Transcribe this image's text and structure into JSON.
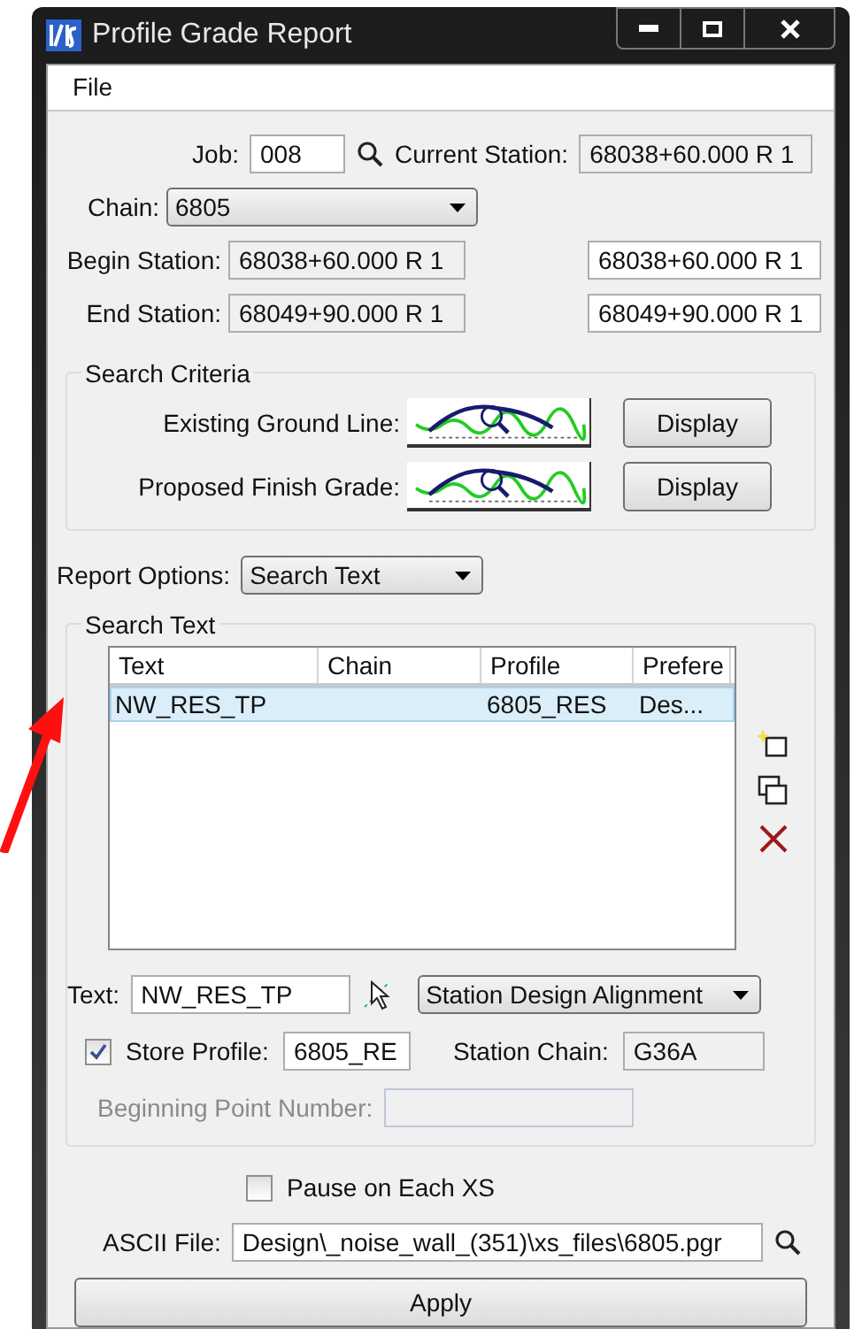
{
  "window": {
    "title": "Profile Grade Report"
  },
  "menu": [
    "File"
  ],
  "job": {
    "label": "Job:",
    "value": "008"
  },
  "current_station": {
    "label": "Current Station:",
    "value": "68038+60.000 R 1"
  },
  "chain": {
    "label": "Chain:",
    "value": "6805"
  },
  "begin_station": {
    "label": "Begin Station:",
    "value": "68038+60.000 R 1",
    "value_2": "68038+60.000 R 1"
  },
  "end_station": {
    "label": "End Station:",
    "value": "68049+90.000 R 1",
    "value_2": "68049+90.000 R 1"
  },
  "search_criteria": {
    "title": "Search Criteria",
    "rows": [
      {
        "label": "Existing Ground Line:",
        "button": "Display"
      },
      {
        "label": "Proposed Finish Grade:",
        "button": "Display"
      }
    ]
  },
  "report_options": {
    "label": "Report Options:",
    "value": "Search Text"
  },
  "search_text": {
    "title": "Search Text",
    "table": {
      "columns": [
        "Text",
        "Chain",
        "Profile",
        "Prefere"
      ],
      "rows": [
        {
          "cells": [
            "NW_RES_TP",
            "",
            "6805_RES",
            "Des..."
          ],
          "selected": true
        }
      ]
    },
    "text": {
      "label": "Text:",
      "value": "NW_RES_TP"
    },
    "alignment": {
      "value": "Station Design Alignment"
    },
    "store_profile": {
      "label": "Store Profile:",
      "checked": true,
      "value": "6805_RE"
    },
    "station_chain": {
      "label": "Station Chain:",
      "value": "G36A"
    },
    "beginning_point": {
      "label": "Beginning Point Number:",
      "disabled": true
    }
  },
  "pause": {
    "label": "Pause on Each XS",
    "checked": false
  },
  "ascii_file": {
    "label": "ASCII File:",
    "value": "Design\\_noise_wall_(351)\\xs_files\\6805.pgr"
  },
  "apply": "Apply"
}
